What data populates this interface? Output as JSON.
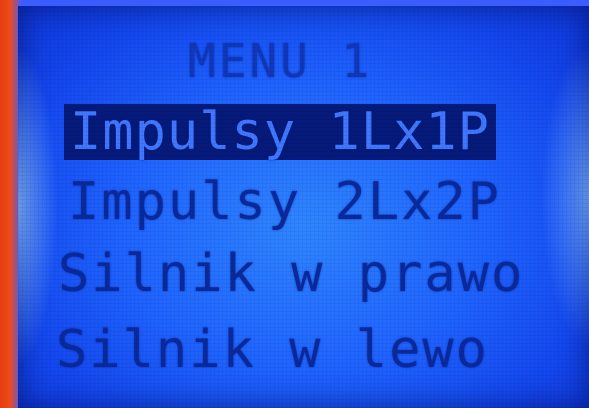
{
  "menu": {
    "title": "MENU 1",
    "selected_index": 0,
    "items": [
      {
        "label": "Impulsy 1Lx1P"
      },
      {
        "label": "Impulsy 2Lx2P"
      },
      {
        "label": "Silnik w prawo"
      },
      {
        "label": "Silnik w lewo"
      }
    ]
  },
  "colors": {
    "backlight": "#1f64ff",
    "pixel_on": "#0a2a9c",
    "highlight_bg": "#051a7a",
    "bezel": "#e8431c"
  }
}
